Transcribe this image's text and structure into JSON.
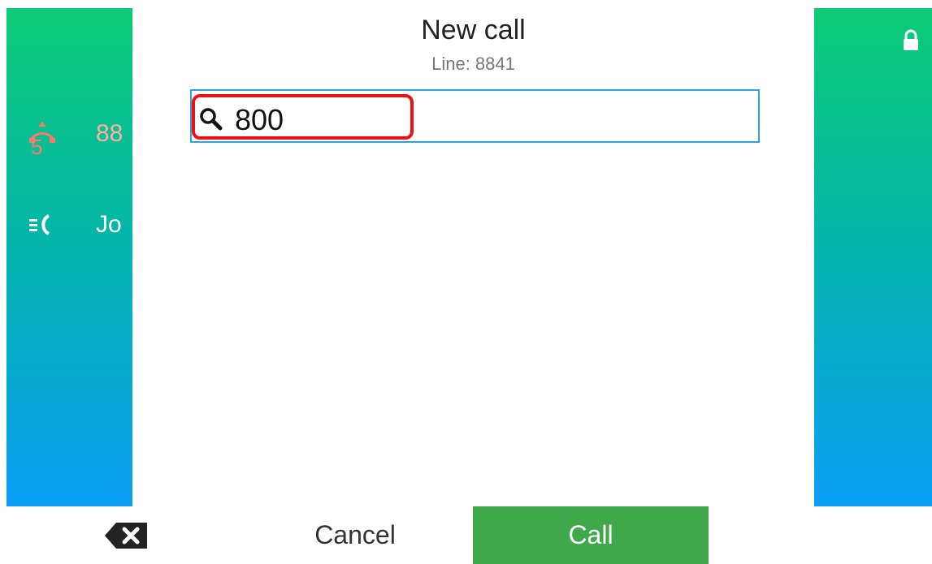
{
  "dialog": {
    "title": "New call",
    "subtitle": "Line: 8841"
  },
  "search": {
    "value": "800"
  },
  "background": {
    "recent_call_text": "88",
    "missed_count": "5",
    "contact_text": "Jo"
  },
  "softkeys": {
    "cancel_label": "Cancel",
    "call_label": "Call"
  },
  "colors": {
    "accent_blue": "#2ea2e4",
    "call_green": "#3ea84a",
    "highlight_red": "#ee1111",
    "missed_red": "#ff7a6a"
  },
  "icons": {
    "search": "search-icon",
    "lock": "lock-icon",
    "backspace": "backspace-icon",
    "missed_call": "missed-call-icon",
    "call_list": "call-list-icon"
  }
}
